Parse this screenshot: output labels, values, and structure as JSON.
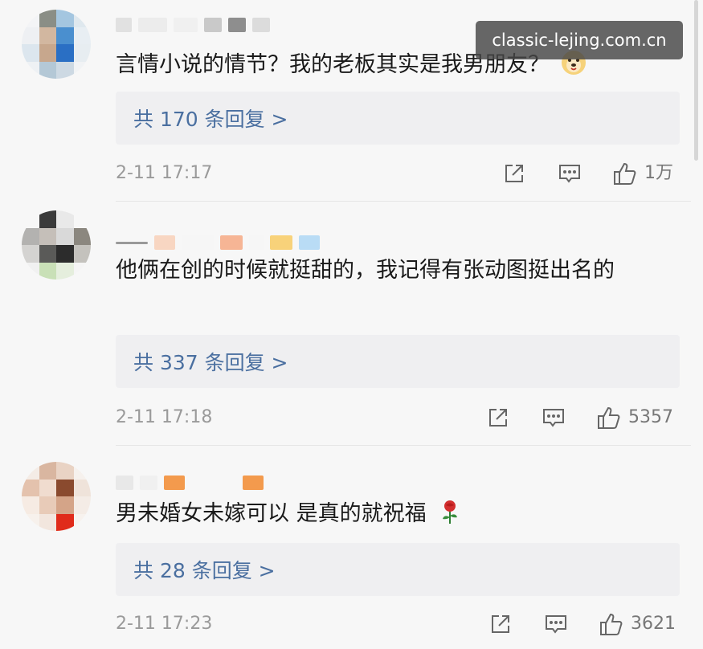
{
  "watermark": "classic-lejing.com.cn",
  "comments": [
    {
      "text": "言情小说的情节？我的老板其实是我男朋友？",
      "replies": "共 170 条回复 >",
      "time": "2-11 17:17",
      "likes": "1万"
    },
    {
      "text": "他俩在创的时候就挺甜的，我记得有张动图挺出名的",
      "replies": "共 337 条回复 >",
      "time": "2-11 17:18",
      "likes": "5357"
    },
    {
      "text": "男未婚女未嫁可以 是真的就祝福",
      "replies": "共 28 条回复 >",
      "time": "2-11 17:23",
      "likes": "3621"
    }
  ],
  "icons": {
    "share": "share-icon",
    "comment": "comment-icon",
    "like": "thumbs-up-icon",
    "emoji1": "dog-emoji-icon",
    "emoji2": "rose-emoji-icon"
  },
  "colors": {
    "link": "#4a6fa0",
    "reply_bg": "#efeff1",
    "meta": "#9a9a9a"
  }
}
